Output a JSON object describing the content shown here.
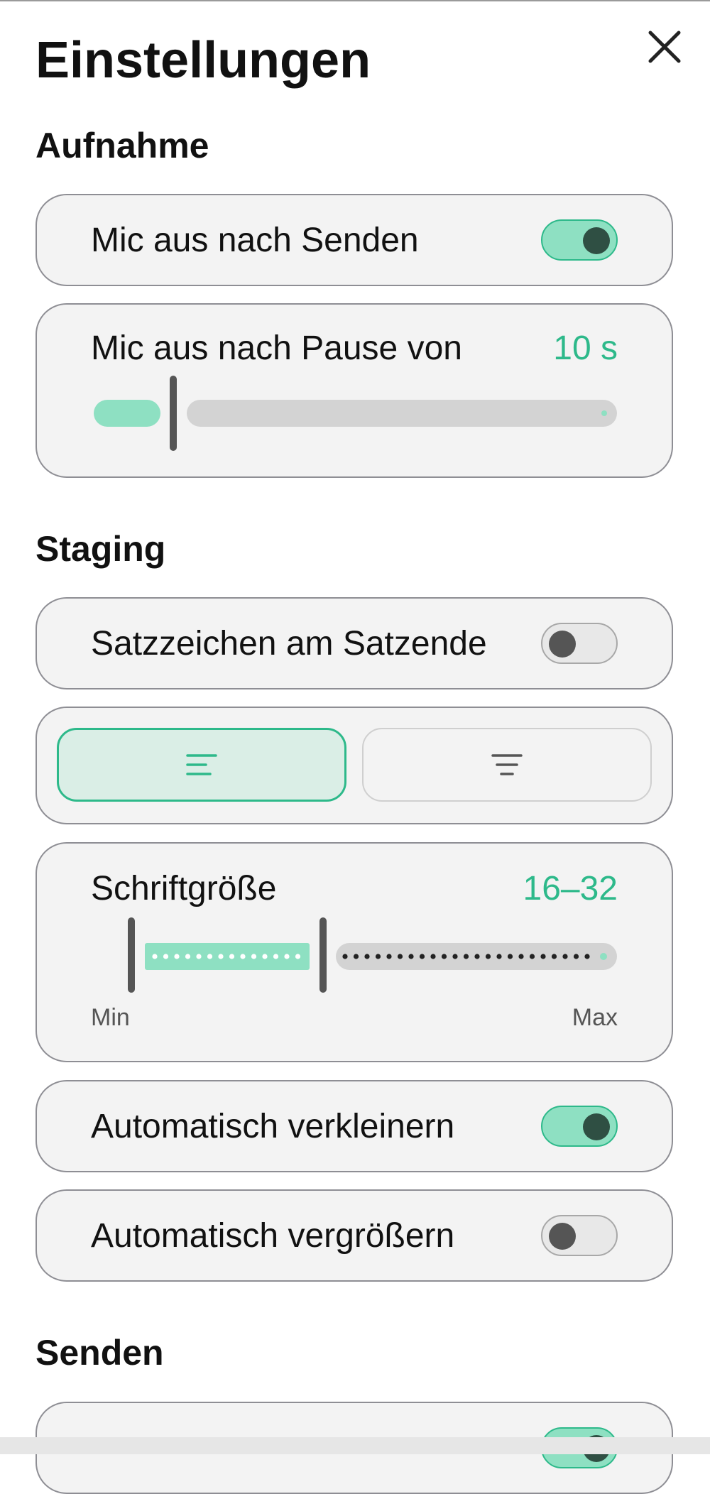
{
  "page": {
    "title": "Einstellungen",
    "close_icon": "close-icon"
  },
  "colors": {
    "accent": "#2db98a",
    "accent_light": "#8ee0c2",
    "card_bg": "#f3f3f3"
  },
  "sections": {
    "recording": "Aufnahme",
    "staging": "Staging",
    "sending": "Senden"
  },
  "recording": {
    "mic_off_after_send": {
      "label": "Mic aus nach Senden",
      "enabled": true
    },
    "mic_off_after_pause": {
      "label": "Mic aus nach Pause von",
      "value": "10 s",
      "slider_fraction": 0.1
    }
  },
  "staging": {
    "punctuation": {
      "label": "Satzzeichen am Satzende",
      "enabled": false
    },
    "alignment": {
      "options": [
        "align-left-icon",
        "align-center-icon"
      ],
      "selected": 0
    },
    "font_size": {
      "label": "Schriftgröße",
      "value": "16–32",
      "min_label": "Min",
      "max_label": "Max",
      "range_fraction": [
        0.0,
        0.375
      ]
    },
    "auto_shrink": {
      "label": "Automatisch verkleinern",
      "enabled": true
    },
    "auto_grow": {
      "label": "Automatisch vergrößern",
      "enabled": false
    }
  },
  "sending": {
    "partial_item": {
      "enabled": true
    }
  }
}
